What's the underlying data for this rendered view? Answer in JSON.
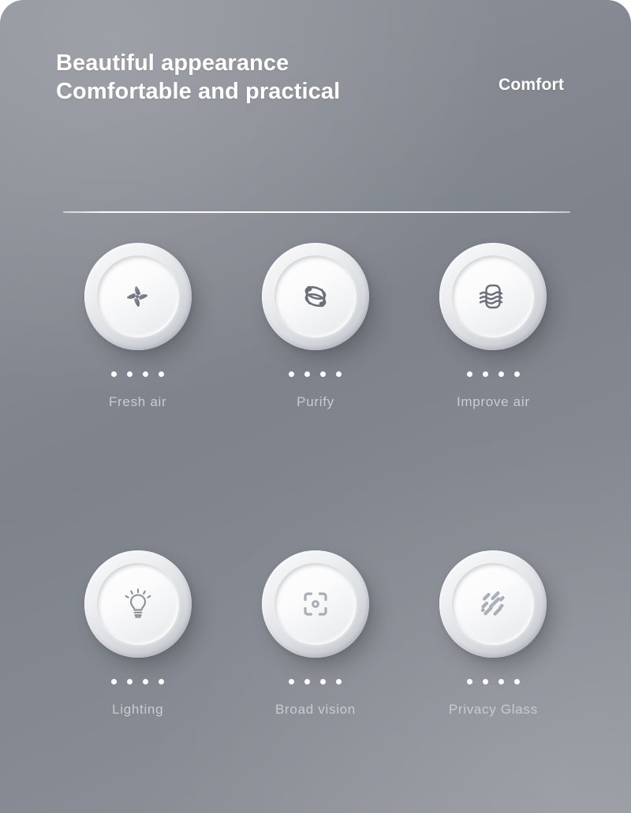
{
  "header": {
    "headline_line1": "Beautiful appearance",
    "headline_line2": "Comfortable and practical",
    "kicker": "Comfort"
  },
  "colors": {
    "background_top": "#8d9198",
    "background_bottom": "#93979e",
    "headline_text": "#ffffff",
    "label_text": "#c9ccd1",
    "dot": "#ffffff",
    "divider": "#ffffff",
    "icon_stroke": "#6b7078"
  },
  "divider": {
    "visible": true
  },
  "features": [
    {
      "label": "Fresh air",
      "icon": "fan-icon",
      "dots": 4
    },
    {
      "label": "Purify",
      "icon": "ion-purify-icon",
      "dots": 4
    },
    {
      "label": "Improve air",
      "icon": "airflow-icon",
      "dots": 4
    },
    {
      "label": "Lighting",
      "icon": "lightbulb-icon",
      "dots": 4
    },
    {
      "label": "Broad vision",
      "icon": "viewfinder-icon",
      "dots": 4
    },
    {
      "label": "Privacy Glass",
      "icon": "rain-streaks-icon",
      "dots": 4
    }
  ]
}
